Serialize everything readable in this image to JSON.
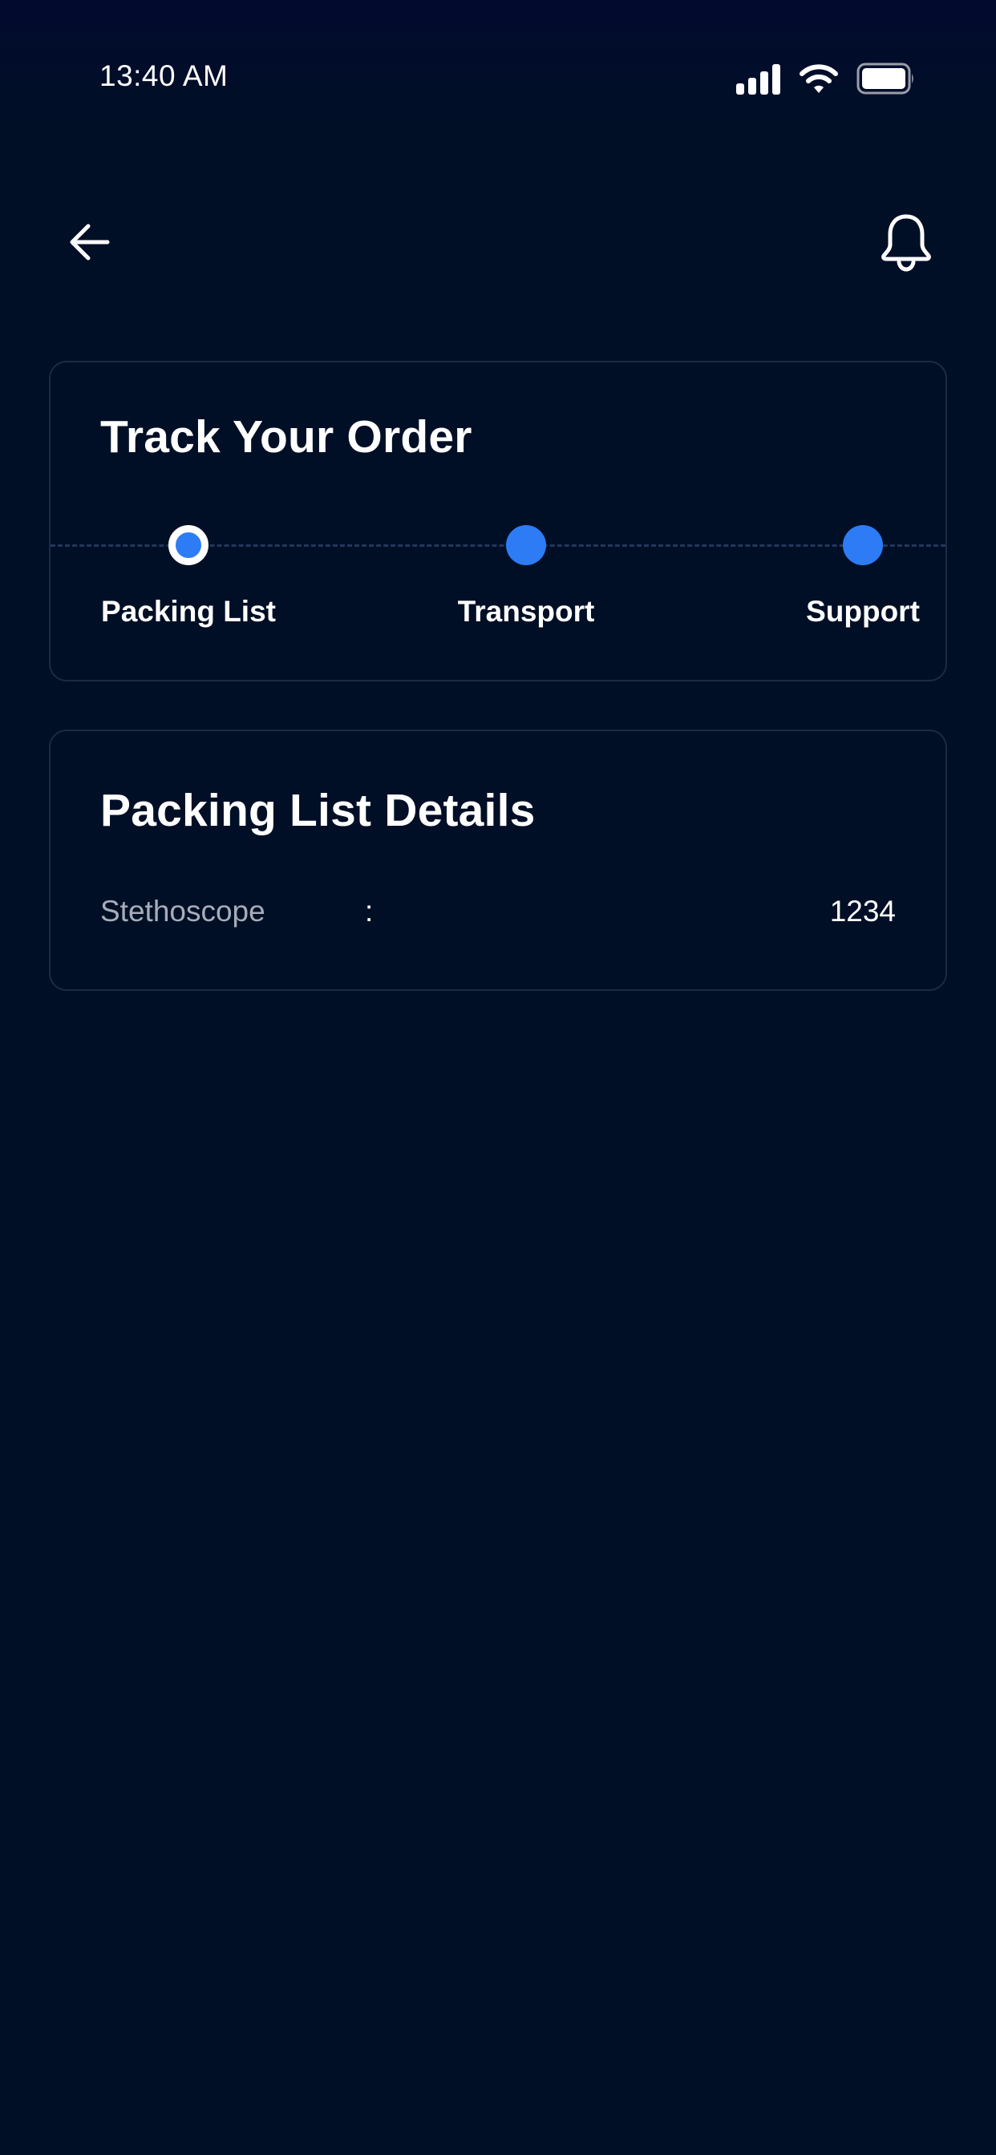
{
  "status_bar": {
    "time": "13:40 AM",
    "icons": [
      "signal-icon",
      "wifi-icon",
      "battery-icon"
    ]
  },
  "header": {
    "back_icon": "arrow-left-icon",
    "notification_icon": "bell-icon"
  },
  "track_order": {
    "title": "Track Your Order",
    "steps": [
      {
        "label": "Packing List",
        "state": "active"
      },
      {
        "label": "Transport",
        "state": "pending"
      },
      {
        "label": "Support",
        "state": "pending"
      }
    ]
  },
  "packing_details": {
    "title": "Packing List Details",
    "rows": [
      {
        "label": "Stethoscope",
        "separator": ":",
        "value": "1234"
      }
    ]
  },
  "colors": {
    "background": "#000f26",
    "accent": "#2d7cf6",
    "card_border": "#1c2a44",
    "muted_text": "#a7adb8"
  }
}
